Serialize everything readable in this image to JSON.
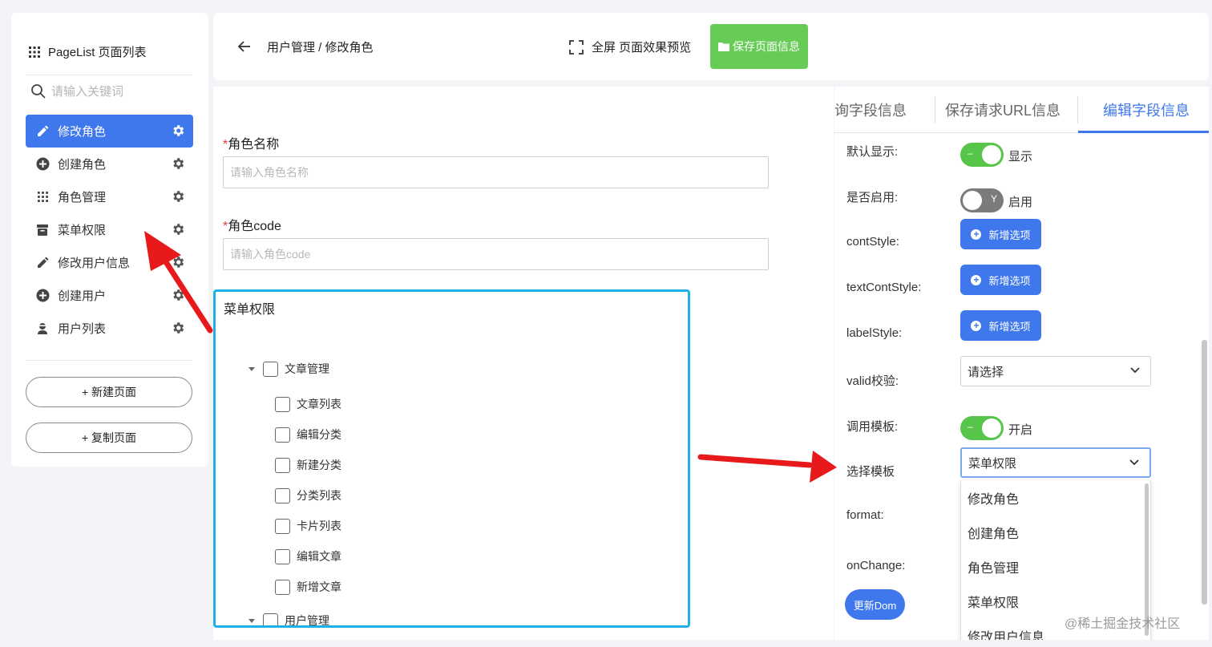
{
  "sidebar": {
    "title": "PageList 页面列表",
    "search_placeholder": "请输入关键词",
    "items": [
      {
        "label": "修改角色",
        "icon": "pencil-icon",
        "active": true
      },
      {
        "label": "创建角色",
        "icon": "plus-circle-icon"
      },
      {
        "label": "角色管理",
        "icon": "grid-icon"
      },
      {
        "label": "菜单权限",
        "icon": "archive-icon"
      },
      {
        "label": "修改用户信息",
        "icon": "pencil-icon"
      },
      {
        "label": "创建用户",
        "icon": "plus-circle-icon"
      },
      {
        "label": "用户列表",
        "icon": "user-icon"
      }
    ],
    "new_page_button": "+ 新建页面",
    "copy_page_button": "+ 复制页面"
  },
  "header": {
    "breadcrumb": "用户管理 / 修改角色",
    "fullscreen_label": "全屏 页面效果预览",
    "save_label": "保存页面信息"
  },
  "form": {
    "role_name_label": "角色名称",
    "role_name_placeholder": "请输入角色名称",
    "role_code_label": "角色code",
    "role_code_placeholder": "请输入角色code",
    "required_mark": "*",
    "menu_permission_title": "菜单权限",
    "tree": {
      "group1": "文章管理",
      "group1_children": [
        "文章列表",
        "编辑分类",
        "新建分类",
        "分类列表",
        "卡片列表",
        "编辑文章",
        "新增文章"
      ],
      "group2": "用户管理"
    }
  },
  "right_panel": {
    "tabs": [
      "询字段信息",
      "保存请求URL信息",
      "编辑字段信息"
    ],
    "active_tab": "编辑字段信息",
    "rows": {
      "default_show_label": "默认显示:",
      "default_show_state": "显示",
      "default_show_mark": "–",
      "enabled_label": "是否启用:",
      "enabled_state": "启用",
      "enabled_mark": "Y",
      "contstyle_label": "contStyle:",
      "textcontstyle_label": "textContStyle:",
      "labelstyle_label": "labelStyle:",
      "add_option": "新增选项",
      "valid_label": "valid校验:",
      "valid_value": "请选择",
      "template_label": "调用模板:",
      "template_state": "开启",
      "template_mark": "–",
      "select_template_label": "选择模板",
      "select_template_value": "菜单权限",
      "format_label": "format:",
      "onchange_label": "onChange:",
      "update_dom": "更新Dom"
    },
    "dropdown_options": [
      "修改角色",
      "创建角色",
      "角色管理",
      "菜单权限",
      "修改用户信息"
    ]
  },
  "watermark": "@稀土掘金技术社区",
  "colors": {
    "primary": "#3f77ec",
    "success": "#66cc55",
    "switch_on": "#57c44a",
    "tree_border": "#1fb0e8",
    "arrow": "#e8191b"
  }
}
